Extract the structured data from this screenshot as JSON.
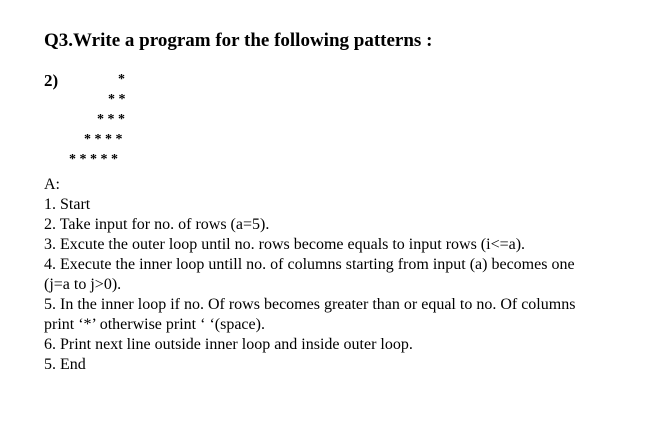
{
  "heading": "Q3.Write a program for the following patterns :",
  "question_number": "2)",
  "pattern_rows": [
    "*",
    "* *",
    "* * *",
    "* * * *",
    "* * * * *"
  ],
  "answer_lines": [
    "A:",
    "1. Start",
    "2. Take input for no. of rows (a=5).",
    "3. Excute the outer loop until no. rows become equals to input rows (i<=a).",
    "4. Execute the inner loop untill no. of columns starting from input (a) becomes one",
    "(j=a to j>0).",
    "5. In the inner loop if no. Of rows becomes greater than or equal to no. Of columns",
    "print ‘*’ otherwise print ‘ ‘(space).",
    "6. Print next line outside inner loop and inside outer loop.",
    "5. End"
  ]
}
